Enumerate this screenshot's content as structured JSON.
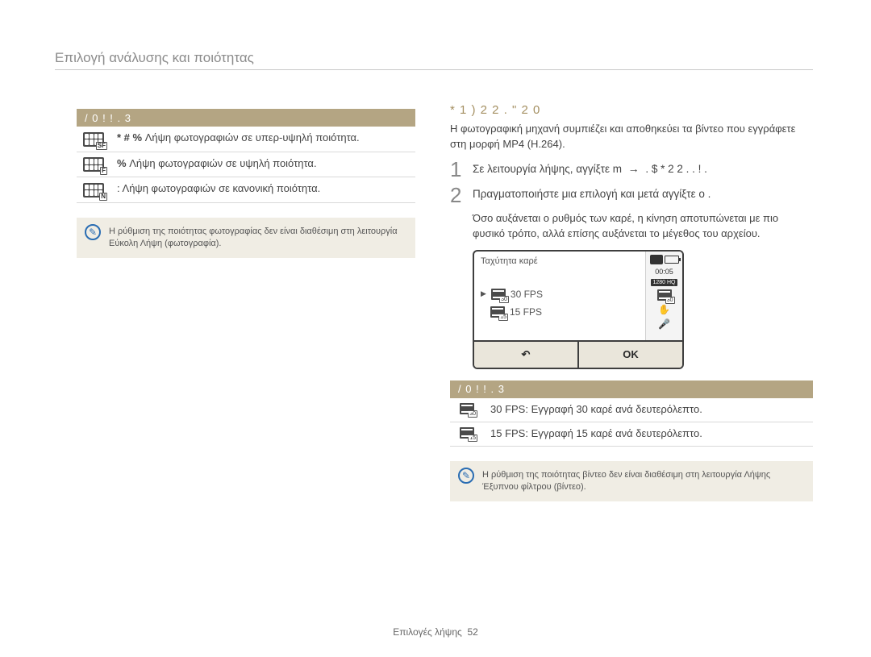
{
  "page_title": "Επιλογή ανάλυσης και ποιότητας",
  "left": {
    "band": "/       0 !    ! . 3",
    "rows": [
      {
        "badge": "SF",
        "label": "* # %",
        "text": "Λήψη φωτογραφιών σε υπερ-υψηλή ποιότητα."
      },
      {
        "badge": "F",
        "label": "%",
        "text": "Λήψη φωτογραφιών σε υψηλή ποιότητα."
      },
      {
        "badge": "N",
        "label": "",
        "text": ": Λήψη φωτογραφιών σε κανονική ποιότητα."
      }
    ],
    "note": "Η ρύθμιση της ποιότητας φωτογραφίας δεν είναι διαθέσιμη στη λειτουργία Εύκολη Λήψη (φωτογραφία)."
  },
  "right": {
    "section_title": "*        1        ) 2   2 . \"      2 0",
    "intro": "Η φωτογραφική μηχανή συμπιέζει και αποθηκεύει τα βίντεο που εγγράφετε στη μορφή MP4 (H.264).",
    "step1_before": "Σε λειτουργία λήψης, αγγίξτε m",
    "step1_after": ". $ * 2   2 . . ! .",
    "step2": "Πραγματοποιήστε μια επιλογή και μετά αγγίξτε o   .",
    "sub_note": "Όσο αυξάνεται ο ρυθμός των καρέ, η κίνηση αποτυπώνεται με πιο φυσικό τρόπο, αλλά επίσης αυξάνεται το μέγεθος του αρχείου.",
    "cam": {
      "menu_title": "Ταχύτητα καρέ",
      "items": [
        {
          "badge": "30",
          "label": "30 FPS",
          "selected": true
        },
        {
          "badge": "15",
          "label": "15 FPS",
          "selected": false
        }
      ],
      "time": "00:05",
      "res": "1280 HQ",
      "back": "↶",
      "ok": "OK"
    },
    "band": "/       0 !    ! . 3",
    "rows": [
      {
        "badge": "30",
        "text": "30 FPS: Εγγραφή 30 καρέ ανά δευτερόλεπτο."
      },
      {
        "badge": "15",
        "text": "15 FPS: Εγγραφή 15 καρέ ανά δευτερόλεπτο."
      }
    ],
    "note": "Η ρύθμιση της ποιότητας βίντεο δεν είναι διαθέσιμη στη λειτουργία Λήψης Έξυπνου φίλτρου (βίντεο)."
  },
  "footer_label": "Επιλογές λήψης",
  "footer_page": "52"
}
